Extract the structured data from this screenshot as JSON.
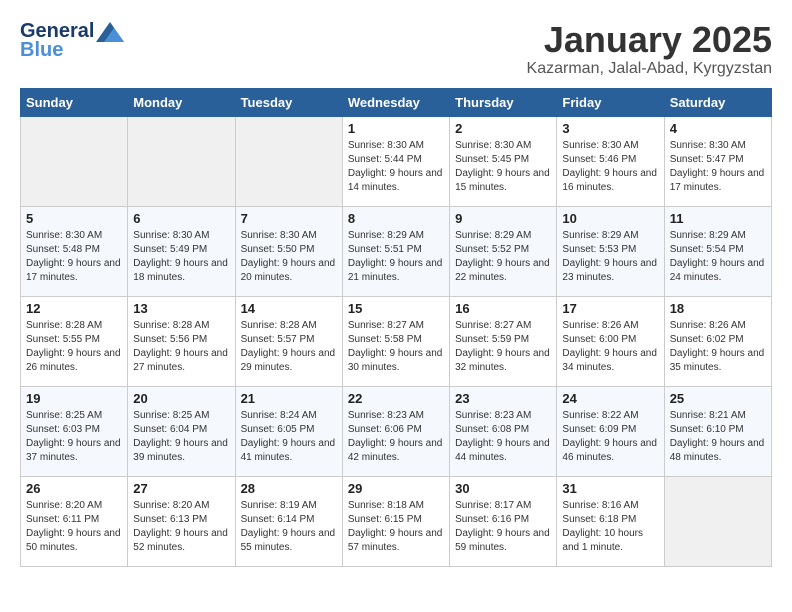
{
  "logo": {
    "line1": "General",
    "line2": "Blue"
  },
  "title": "January 2025",
  "subtitle": "Kazarman, Jalal-Abad, Kyrgyzstan",
  "days_of_week": [
    "Sunday",
    "Monday",
    "Tuesday",
    "Wednesday",
    "Thursday",
    "Friday",
    "Saturday"
  ],
  "weeks": [
    [
      {
        "day": "",
        "sunrise": "",
        "sunset": "",
        "daylight": ""
      },
      {
        "day": "",
        "sunrise": "",
        "sunset": "",
        "daylight": ""
      },
      {
        "day": "",
        "sunrise": "",
        "sunset": "",
        "daylight": ""
      },
      {
        "day": "1",
        "sunrise": "Sunrise: 8:30 AM",
        "sunset": "Sunset: 5:44 PM",
        "daylight": "Daylight: 9 hours and 14 minutes."
      },
      {
        "day": "2",
        "sunrise": "Sunrise: 8:30 AM",
        "sunset": "Sunset: 5:45 PM",
        "daylight": "Daylight: 9 hours and 15 minutes."
      },
      {
        "day": "3",
        "sunrise": "Sunrise: 8:30 AM",
        "sunset": "Sunset: 5:46 PM",
        "daylight": "Daylight: 9 hours and 16 minutes."
      },
      {
        "day": "4",
        "sunrise": "Sunrise: 8:30 AM",
        "sunset": "Sunset: 5:47 PM",
        "daylight": "Daylight: 9 hours and 17 minutes."
      }
    ],
    [
      {
        "day": "5",
        "sunrise": "Sunrise: 8:30 AM",
        "sunset": "Sunset: 5:48 PM",
        "daylight": "Daylight: 9 hours and 17 minutes."
      },
      {
        "day": "6",
        "sunrise": "Sunrise: 8:30 AM",
        "sunset": "Sunset: 5:49 PM",
        "daylight": "Daylight: 9 hours and 18 minutes."
      },
      {
        "day": "7",
        "sunrise": "Sunrise: 8:30 AM",
        "sunset": "Sunset: 5:50 PM",
        "daylight": "Daylight: 9 hours and 20 minutes."
      },
      {
        "day": "8",
        "sunrise": "Sunrise: 8:29 AM",
        "sunset": "Sunset: 5:51 PM",
        "daylight": "Daylight: 9 hours and 21 minutes."
      },
      {
        "day": "9",
        "sunrise": "Sunrise: 8:29 AM",
        "sunset": "Sunset: 5:52 PM",
        "daylight": "Daylight: 9 hours and 22 minutes."
      },
      {
        "day": "10",
        "sunrise": "Sunrise: 8:29 AM",
        "sunset": "Sunset: 5:53 PM",
        "daylight": "Daylight: 9 hours and 23 minutes."
      },
      {
        "day": "11",
        "sunrise": "Sunrise: 8:29 AM",
        "sunset": "Sunset: 5:54 PM",
        "daylight": "Daylight: 9 hours and 24 minutes."
      }
    ],
    [
      {
        "day": "12",
        "sunrise": "Sunrise: 8:28 AM",
        "sunset": "Sunset: 5:55 PM",
        "daylight": "Daylight: 9 hours and 26 minutes."
      },
      {
        "day": "13",
        "sunrise": "Sunrise: 8:28 AM",
        "sunset": "Sunset: 5:56 PM",
        "daylight": "Daylight: 9 hours and 27 minutes."
      },
      {
        "day": "14",
        "sunrise": "Sunrise: 8:28 AM",
        "sunset": "Sunset: 5:57 PM",
        "daylight": "Daylight: 9 hours and 29 minutes."
      },
      {
        "day": "15",
        "sunrise": "Sunrise: 8:27 AM",
        "sunset": "Sunset: 5:58 PM",
        "daylight": "Daylight: 9 hours and 30 minutes."
      },
      {
        "day": "16",
        "sunrise": "Sunrise: 8:27 AM",
        "sunset": "Sunset: 5:59 PM",
        "daylight": "Daylight: 9 hours and 32 minutes."
      },
      {
        "day": "17",
        "sunrise": "Sunrise: 8:26 AM",
        "sunset": "Sunset: 6:00 PM",
        "daylight": "Daylight: 9 hours and 34 minutes."
      },
      {
        "day": "18",
        "sunrise": "Sunrise: 8:26 AM",
        "sunset": "Sunset: 6:02 PM",
        "daylight": "Daylight: 9 hours and 35 minutes."
      }
    ],
    [
      {
        "day": "19",
        "sunrise": "Sunrise: 8:25 AM",
        "sunset": "Sunset: 6:03 PM",
        "daylight": "Daylight: 9 hours and 37 minutes."
      },
      {
        "day": "20",
        "sunrise": "Sunrise: 8:25 AM",
        "sunset": "Sunset: 6:04 PM",
        "daylight": "Daylight: 9 hours and 39 minutes."
      },
      {
        "day": "21",
        "sunrise": "Sunrise: 8:24 AM",
        "sunset": "Sunset: 6:05 PM",
        "daylight": "Daylight: 9 hours and 41 minutes."
      },
      {
        "day": "22",
        "sunrise": "Sunrise: 8:23 AM",
        "sunset": "Sunset: 6:06 PM",
        "daylight": "Daylight: 9 hours and 42 minutes."
      },
      {
        "day": "23",
        "sunrise": "Sunrise: 8:23 AM",
        "sunset": "Sunset: 6:08 PM",
        "daylight": "Daylight: 9 hours and 44 minutes."
      },
      {
        "day": "24",
        "sunrise": "Sunrise: 8:22 AM",
        "sunset": "Sunset: 6:09 PM",
        "daylight": "Daylight: 9 hours and 46 minutes."
      },
      {
        "day": "25",
        "sunrise": "Sunrise: 8:21 AM",
        "sunset": "Sunset: 6:10 PM",
        "daylight": "Daylight: 9 hours and 48 minutes."
      }
    ],
    [
      {
        "day": "26",
        "sunrise": "Sunrise: 8:20 AM",
        "sunset": "Sunset: 6:11 PM",
        "daylight": "Daylight: 9 hours and 50 minutes."
      },
      {
        "day": "27",
        "sunrise": "Sunrise: 8:20 AM",
        "sunset": "Sunset: 6:13 PM",
        "daylight": "Daylight: 9 hours and 52 minutes."
      },
      {
        "day": "28",
        "sunrise": "Sunrise: 8:19 AM",
        "sunset": "Sunset: 6:14 PM",
        "daylight": "Daylight: 9 hours and 55 minutes."
      },
      {
        "day": "29",
        "sunrise": "Sunrise: 8:18 AM",
        "sunset": "Sunset: 6:15 PM",
        "daylight": "Daylight: 9 hours and 57 minutes."
      },
      {
        "day": "30",
        "sunrise": "Sunrise: 8:17 AM",
        "sunset": "Sunset: 6:16 PM",
        "daylight": "Daylight: 9 hours and 59 minutes."
      },
      {
        "day": "31",
        "sunrise": "Sunrise: 8:16 AM",
        "sunset": "Sunset: 6:18 PM",
        "daylight": "Daylight: 10 hours and 1 minute."
      },
      {
        "day": "",
        "sunrise": "",
        "sunset": "",
        "daylight": ""
      }
    ]
  ]
}
